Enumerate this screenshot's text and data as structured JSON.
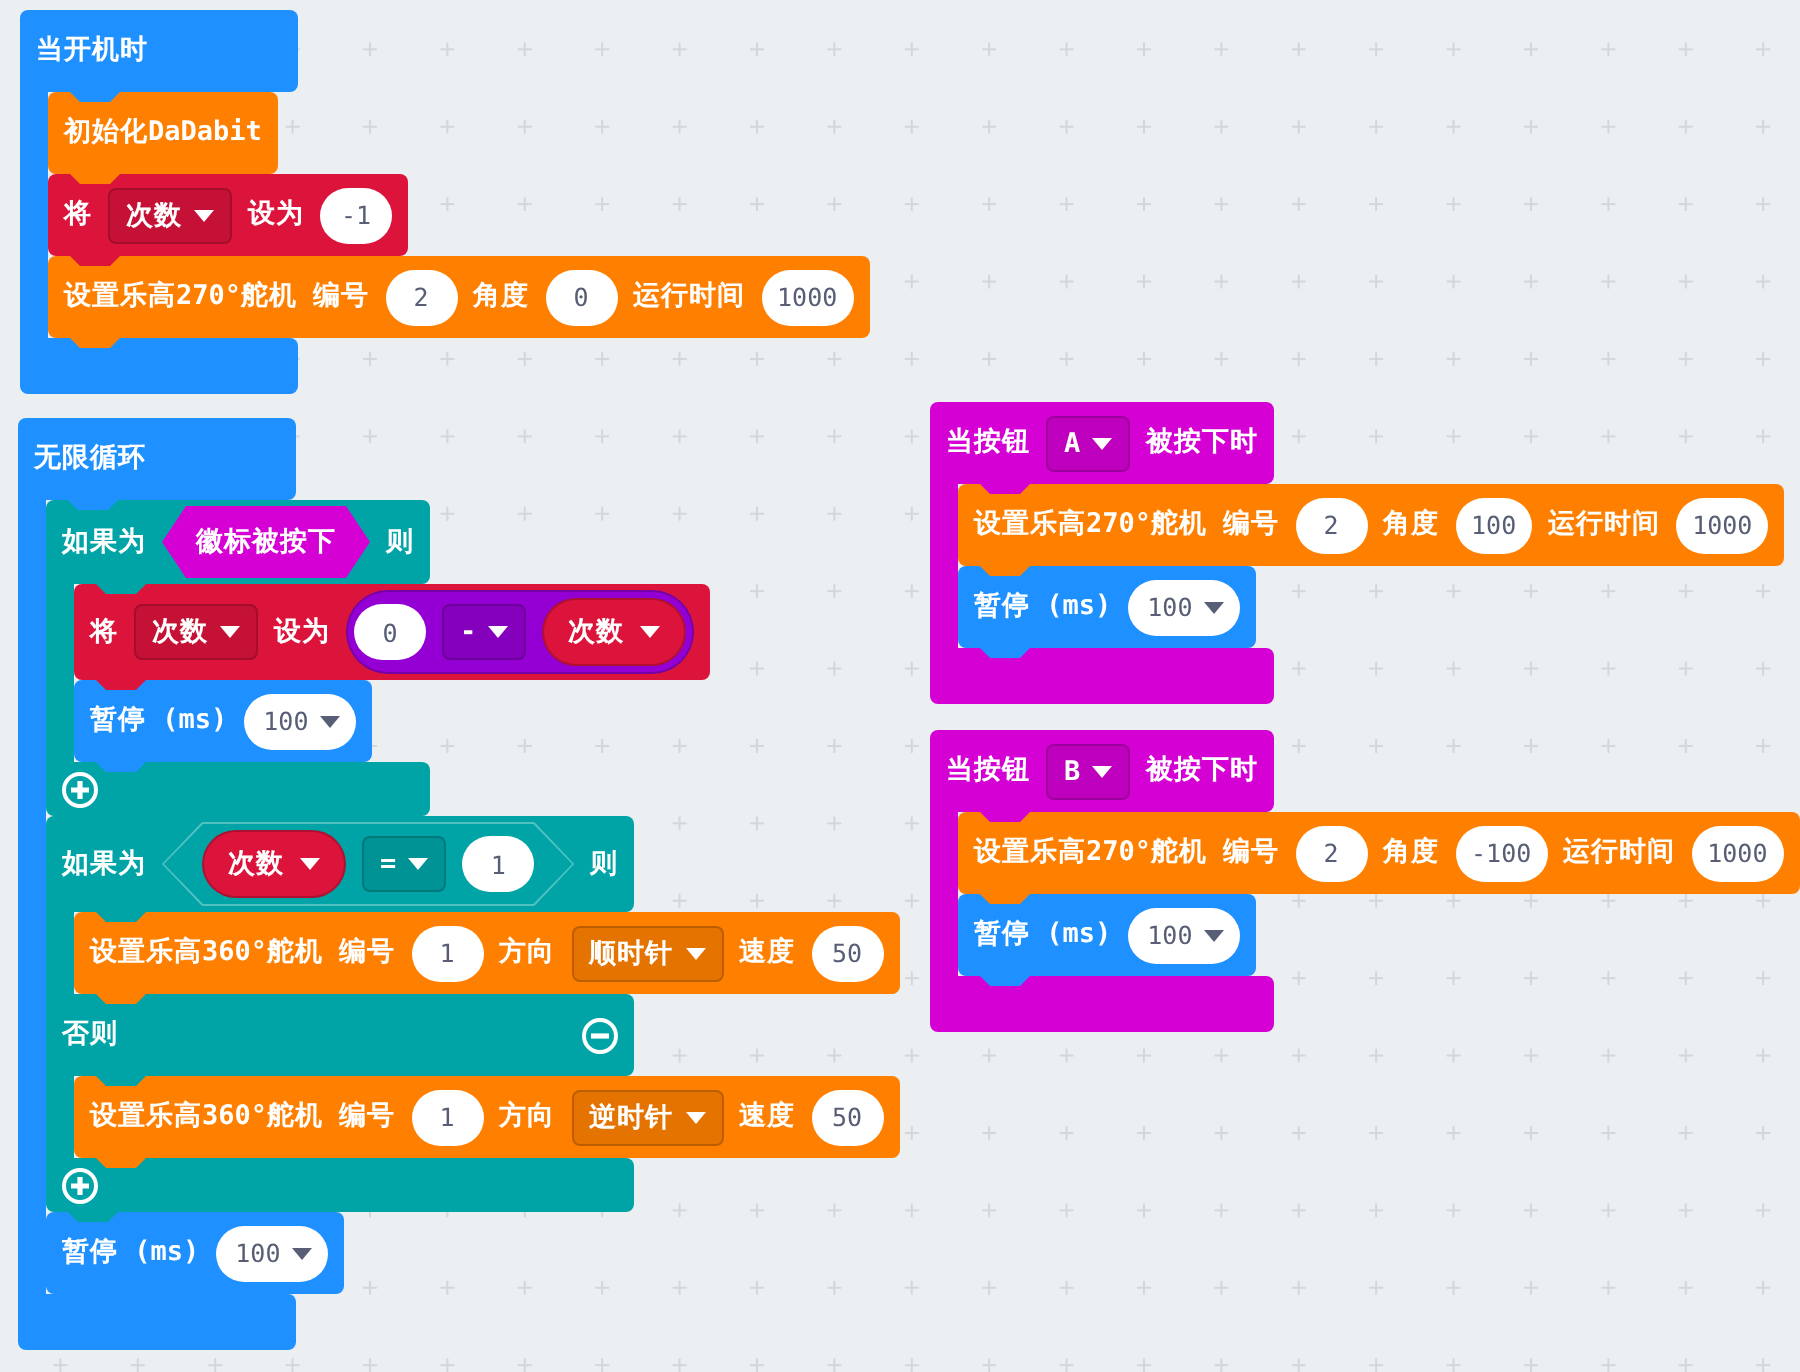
{
  "stacks": [
    {
      "kind": "container",
      "color": "#1e90ff",
      "parts": [
        {
          "kind": "label",
          "text": "当开机时"
        }
      ],
      "body": [
        {
          "kind": "statement",
          "color": "#ff8000",
          "parts": [
            {
              "kind": "label",
              "text": "初始化DaDabit"
            }
          ]
        },
        {
          "kind": "statement",
          "color": "#dc143c",
          "parts": [
            {
              "kind": "label",
              "text": "将"
            },
            {
              "kind": "dropdown",
              "text": "次数"
            },
            {
              "kind": "label",
              "text": "设为"
            },
            {
              "kind": "number",
              "text": "-1"
            }
          ]
        },
        {
          "kind": "statement",
          "color": "#ff8000",
          "parts": [
            {
              "kind": "label",
              "text": "设置乐高270°舵机"
            },
            {
              "kind": "label",
              "text": "编号"
            },
            {
              "kind": "number",
              "text": "2"
            },
            {
              "kind": "label",
              "text": "角度"
            },
            {
              "kind": "number",
              "text": "0"
            },
            {
              "kind": "label",
              "text": "运行时间"
            },
            {
              "kind": "number",
              "text": "1000"
            }
          ]
        }
      ]
    },
    {
      "kind": "container",
      "color": "#1e90ff",
      "parts": [
        {
          "kind": "label",
          "text": "无限循环"
        }
      ],
      "body": [
        {
          "kind": "if",
          "color": "#00a4a6",
          "branches": [
            {
              "parts": [
                {
                  "kind": "label",
                  "text": "如果为"
                },
                {
                  "kind": "boolean",
                  "color": "#d400d4",
                  "text": "徽标被按下"
                },
                {
                  "kind": "label",
                  "text": "则"
                }
              ],
              "body": [
                {
                  "kind": "statement",
                  "color": "#dc143c",
                  "parts": [
                    {
                      "kind": "label",
                      "text": "将"
                    },
                    {
                      "kind": "dropdown",
                      "text": "次数"
                    },
                    {
                      "kind": "label",
                      "text": "设为"
                    },
                    {
                      "kind": "math",
                      "color": "#9400d3",
                      "parts": [
                        {
                          "kind": "number",
                          "text": "0"
                        },
                        {
                          "kind": "dropdown",
                          "text": "-"
                        },
                        {
                          "kind": "variable",
                          "color": "#dc143c",
                          "text": "次数"
                        }
                      ]
                    }
                  ]
                },
                {
                  "kind": "statement",
                  "color": "#1e90ff",
                  "parts": [
                    {
                      "kind": "label",
                      "text": "暂停 (ms)"
                    },
                    {
                      "kind": "number_dropdown",
                      "text": "100"
                    }
                  ]
                }
              ]
            }
          ]
        },
        {
          "kind": "if",
          "color": "#00a4a6",
          "branches": [
            {
              "parts": [
                {
                  "kind": "label",
                  "text": "如果为"
                },
                {
                  "kind": "compare",
                  "parts": [
                    {
                      "kind": "variable",
                      "color": "#dc143c",
                      "text": "次数"
                    },
                    {
                      "kind": "dropdown",
                      "text": "="
                    },
                    {
                      "kind": "number",
                      "text": "1"
                    }
                  ]
                },
                {
                  "kind": "label",
                  "text": "则"
                }
              ],
              "body": [
                {
                  "kind": "statement",
                  "color": "#ff8000",
                  "parts": [
                    {
                      "kind": "label",
                      "text": "设置乐高360°舵机"
                    },
                    {
                      "kind": "label",
                      "text": "编号"
                    },
                    {
                      "kind": "number",
                      "text": "1"
                    },
                    {
                      "kind": "label",
                      "text": "方向"
                    },
                    {
                      "kind": "dropdown",
                      "text": "顺时针"
                    },
                    {
                      "kind": "label",
                      "text": "速度"
                    },
                    {
                      "kind": "number",
                      "text": "50"
                    }
                  ]
                }
              ]
            },
            {
              "parts": [
                {
                  "kind": "label",
                  "text": "否则"
                }
              ],
              "body": [
                {
                  "kind": "statement",
                  "color": "#ff8000",
                  "parts": [
                    {
                      "kind": "label",
                      "text": "设置乐高360°舵机"
                    },
                    {
                      "kind": "label",
                      "text": "编号"
                    },
                    {
                      "kind": "number",
                      "text": "1"
                    },
                    {
                      "kind": "label",
                      "text": "方向"
                    },
                    {
                      "kind": "dropdown",
                      "text": "逆时针"
                    },
                    {
                      "kind": "label",
                      "text": "速度"
                    },
                    {
                      "kind": "number",
                      "text": "50"
                    }
                  ]
                }
              ]
            }
          ]
        },
        {
          "kind": "statement",
          "color": "#1e90ff",
          "parts": [
            {
              "kind": "label",
              "text": "暂停 (ms)"
            },
            {
              "kind": "number_dropdown",
              "text": "100"
            }
          ]
        }
      ]
    },
    {
      "kind": "container",
      "color": "#d400d4",
      "parts": [
        {
          "kind": "label",
          "text": "当按钮"
        },
        {
          "kind": "dropdown",
          "text": "A"
        },
        {
          "kind": "label",
          "text": "被按下时"
        }
      ],
      "body": [
        {
          "kind": "statement",
          "color": "#ff8000",
          "parts": [
            {
              "kind": "label",
              "text": "设置乐高270°舵机"
            },
            {
              "kind": "label",
              "text": "编号"
            },
            {
              "kind": "number",
              "text": "2"
            },
            {
              "kind": "label",
              "text": "角度"
            },
            {
              "kind": "number",
              "text": "100"
            },
            {
              "kind": "label",
              "text": "运行时间"
            },
            {
              "kind": "number",
              "text": "1000"
            }
          ]
        },
        {
          "kind": "statement",
          "color": "#1e90ff",
          "parts": [
            {
              "kind": "label",
              "text": "暂停 (ms)"
            },
            {
              "kind": "number_dropdown",
              "text": "100"
            }
          ]
        }
      ]
    },
    {
      "kind": "container",
      "color": "#d400d4",
      "parts": [
        {
          "kind": "label",
          "text": "当按钮"
        },
        {
          "kind": "dropdown",
          "text": "B"
        },
        {
          "kind": "label",
          "text": "被按下时"
        }
      ],
      "body": [
        {
          "kind": "statement",
          "color": "#ff8000",
          "parts": [
            {
              "kind": "label",
              "text": "设置乐高270°舵机"
            },
            {
              "kind": "label",
              "text": "编号"
            },
            {
              "kind": "number",
              "text": "2"
            },
            {
              "kind": "label",
              "text": "角度"
            },
            {
              "kind": "number",
              "text": "-100"
            },
            {
              "kind": "label",
              "text": "运行时间"
            },
            {
              "kind": "number",
              "text": "1000"
            }
          ]
        },
        {
          "kind": "statement",
          "color": "#1e90ff",
          "parts": [
            {
              "kind": "label",
              "text": "暂停 (ms)"
            },
            {
              "kind": "number_dropdown",
              "text": "100"
            }
          ]
        }
      ]
    }
  ]
}
